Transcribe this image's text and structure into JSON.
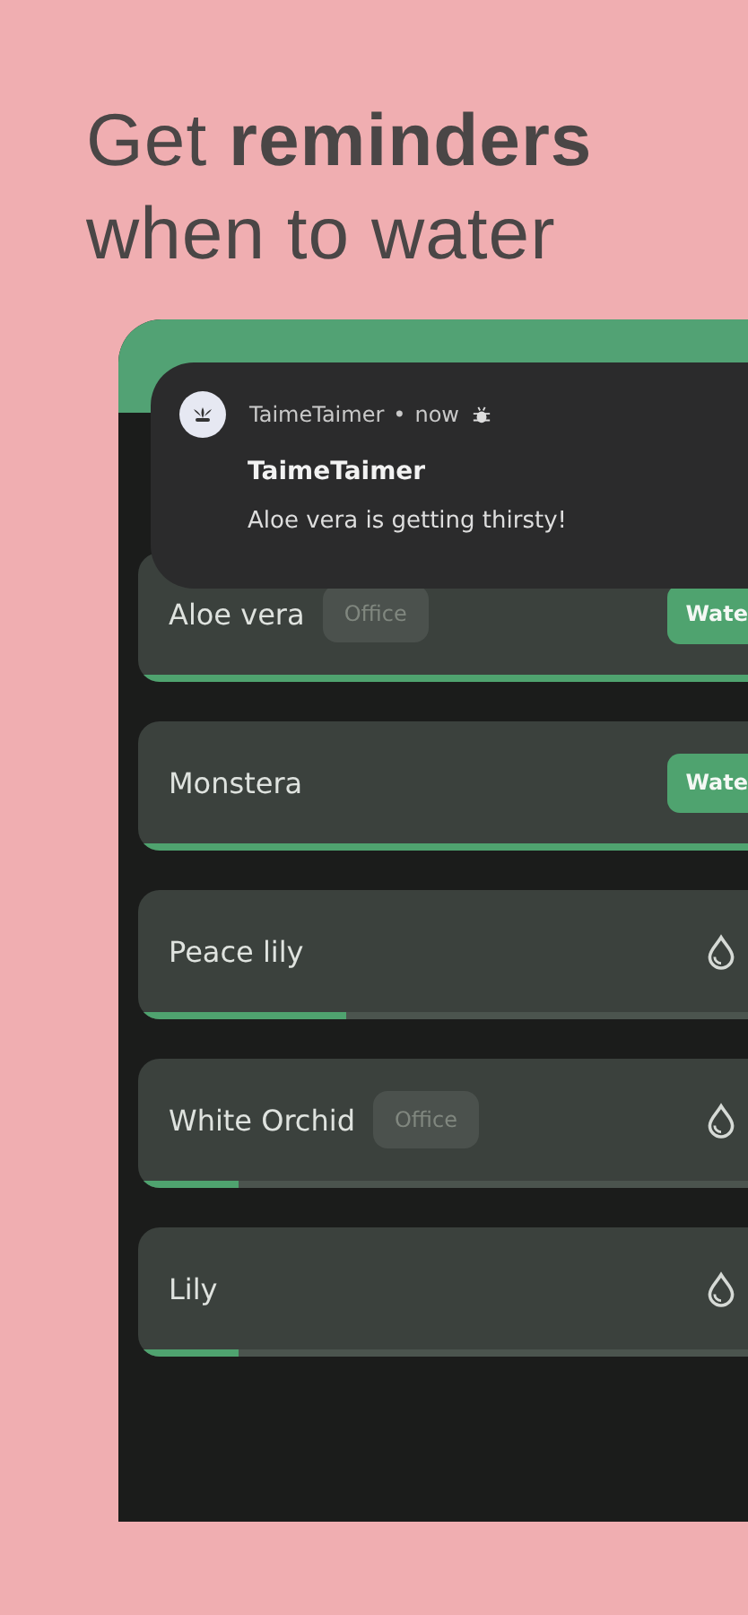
{
  "headline": [
    "Get **reminders**",
    "when to water"
  ],
  "notification": {
    "app": "TaimeTaimer",
    "separator": "•",
    "time": "now",
    "title": "TaimeTaimer",
    "message": "Aloe vera is getting thirsty!"
  },
  "plants": [
    {
      "name": "Aloe vera",
      "tag": "Office",
      "kind": "due",
      "button": "Wate",
      "level": 1
    },
    {
      "name": "Monstera",
      "kind": "due",
      "button": "Wate",
      "level": 1
    },
    {
      "name": "Peace lily",
      "kind": "ok",
      "level": 0.34
    },
    {
      "name": "White Orchid",
      "tag": "Office",
      "kind": "ok",
      "level": 0.165
    },
    {
      "name": "Lily",
      "kind": "ok",
      "level": 0.165
    }
  ]
}
